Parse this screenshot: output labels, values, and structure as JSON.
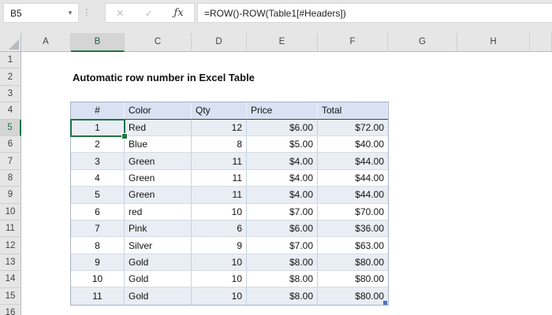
{
  "formula_bar": {
    "name_box_value": "B5",
    "dropdown_icon": "▾",
    "dots_icon": "⋮",
    "cancel_icon": "✕",
    "enter_icon": "✓",
    "insert_function_icon": "ƒx",
    "formula": "=ROW()-ROW(Table1[#Headers])"
  },
  "sheet": {
    "column_headers": [
      "A",
      "B",
      "C",
      "D",
      "E",
      "F",
      "G",
      "H",
      ""
    ],
    "row_headers": [
      "1",
      "2",
      "3",
      "4",
      "5",
      "6",
      "7",
      "8",
      "9",
      "10",
      "11",
      "12",
      "13",
      "14",
      "15",
      "16"
    ],
    "selected_column": "B",
    "selected_row": "5",
    "active_cell": "B5",
    "title": "Automatic row number in Excel Table",
    "table": {
      "name": "Table1",
      "headers": [
        "#",
        "Color",
        "Qty",
        "Price",
        "Total"
      ],
      "rows": [
        [
          "1",
          "Red",
          "12",
          "$6.00",
          "$72.00"
        ],
        [
          "2",
          "Blue",
          "8",
          "$5.00",
          "$40.00"
        ],
        [
          "3",
          "Green",
          "11",
          "$4.00",
          "$44.00"
        ],
        [
          "4",
          "Green",
          "11",
          "$4.00",
          "$44.00"
        ],
        [
          "5",
          "Green",
          "11",
          "$4.00",
          "$44.00"
        ],
        [
          "6",
          "red",
          "10",
          "$7.00",
          "$70.00"
        ],
        [
          "7",
          "Pink",
          "6",
          "$6.00",
          "$36.00"
        ],
        [
          "8",
          "Silver",
          "9",
          "$7.00",
          "$63.00"
        ],
        [
          "9",
          "Gold",
          "10",
          "$8.00",
          "$80.00"
        ],
        [
          "10",
          "Gold",
          "10",
          "$8.00",
          "$80.00"
        ],
        [
          "11",
          "Gold",
          "10",
          "$8.00",
          "$80.00"
        ]
      ]
    }
  },
  "colors": {
    "excel_green": "#217346",
    "table_header_fill": "#d9e1f2",
    "banded_row_fill": "#e9edf4",
    "resize_handle_blue": "#4472c4",
    "header_gray": "#e6e6e6"
  }
}
